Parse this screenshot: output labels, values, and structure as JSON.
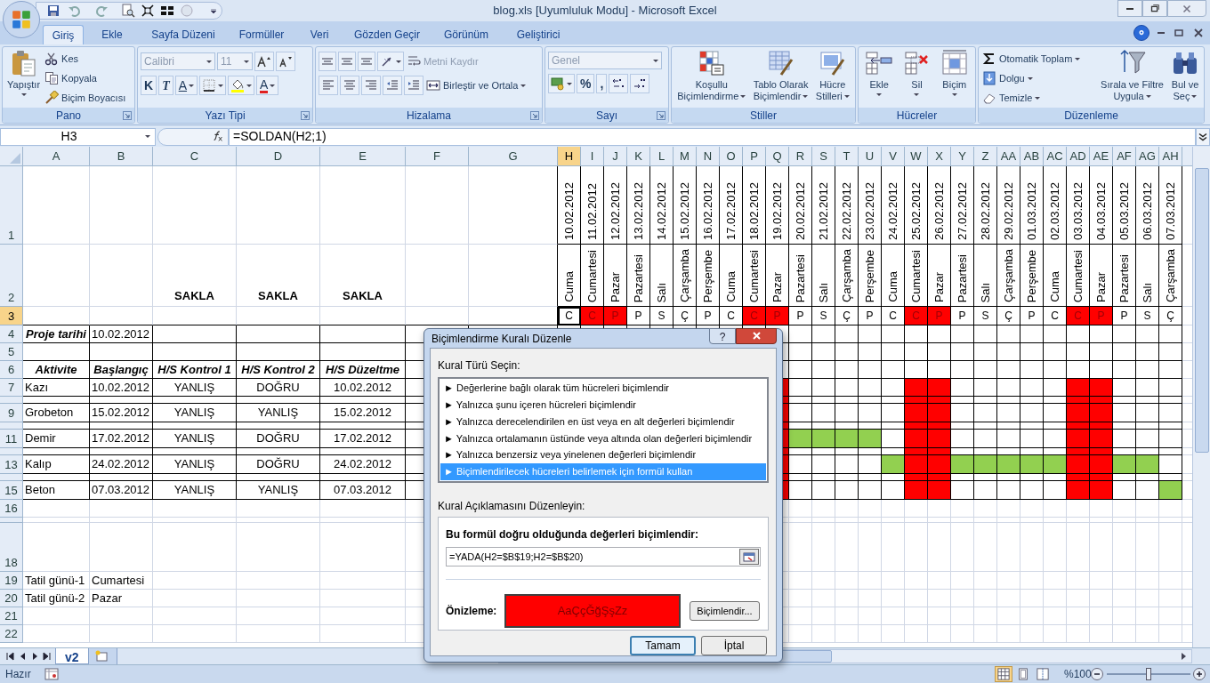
{
  "window": {
    "title": "blog.xls  [Uyumluluk Modu] - Microsoft Excel"
  },
  "ribbon_tabs": [
    {
      "label": "Giriş",
      "selected": true
    },
    {
      "label": "Ekle",
      "selected": false
    },
    {
      "label": "Sayfa Düzeni",
      "selected": false
    },
    {
      "label": "Formüller",
      "selected": false
    },
    {
      "label": "Veri",
      "selected": false
    },
    {
      "label": "Gözden Geçir",
      "selected": false
    },
    {
      "label": "Görünüm",
      "selected": false
    },
    {
      "label": "Geliştirici",
      "selected": false
    }
  ],
  "ribbon_groups": [
    {
      "title": "Pano",
      "kind": "large_first",
      "launcher": true,
      "items": [
        {
          "kind": "large",
          "lines": [
            "Yapıştır"
          ],
          "menu": true,
          "disabled": false
        },
        {
          "kind": "small",
          "label": "Kes",
          "menu": false,
          "disabled": false
        },
        {
          "kind": "small",
          "label": "Kopyala",
          "menu": false,
          "disabled": false
        },
        {
          "kind": "small",
          "label": "Biçim Boyacısı",
          "menu": false,
          "disabled": false
        }
      ]
    },
    {
      "title": "Yazı Tipi",
      "kind": "lines",
      "launcher": true,
      "lines": [
        [
          {
            "kind": "combo",
            "value": "Calibri",
            "menu": true,
            "disabled": true
          },
          {
            "kind": "combo",
            "value": "11",
            "menu": true,
            "disabled": true
          },
          {
            "kind": "icon",
            "menu": false,
            "disabled": false
          },
          {
            "kind": "icon",
            "menu": false,
            "disabled": false
          }
        ],
        [
          {
            "kind": "glyph",
            "label": "K",
            "menu": false,
            "disabled": false
          },
          {
            "kind": "glyph",
            "label": "T",
            "menu": false,
            "disabled": false
          },
          {
            "kind": "glyph",
            "label": "A",
            "menu": true,
            "disabled": false
          },
          {
            "kind": "icon",
            "menu": true,
            "disabled": false
          },
          {
            "kind": "icon",
            "menu": true,
            "disabled": false
          },
          {
            "kind": "glyph",
            "label": "A",
            "menu": true,
            "disabled": false
          }
        ]
      ]
    },
    {
      "title": "Hizalama",
      "kind": "lines",
      "launcher": true,
      "lines": [
        [
          {
            "kind": "icon",
            "menu": false,
            "disabled": false
          },
          {
            "kind": "icon",
            "menu": false,
            "disabled": false
          },
          {
            "kind": "icon",
            "menu": false,
            "disabled": false
          },
          {
            "kind": "icon",
            "menu": true,
            "disabled": false
          },
          {
            "kind": "small",
            "label": "Metni Kaydır",
            "menu": false,
            "disabled": true
          }
        ],
        [
          {
            "kind": "icon",
            "menu": false,
            "disabled": false
          },
          {
            "kind": "icon",
            "menu": false,
            "disabled": false
          },
          {
            "kind": "icon",
            "menu": false,
            "disabled": false
          },
          {
            "kind": "icon",
            "menu": false,
            "disabled": false
          },
          {
            "kind": "icon",
            "menu": false,
            "disabled": false
          },
          {
            "kind": "small",
            "label": "Birleştir ve Ortala",
            "menu": true,
            "disabled": false
          }
        ]
      ]
    },
    {
      "title": "Sayı",
      "kind": "lines",
      "launcher": true,
      "lines": [
        [
          {
            "kind": "combo",
            "value": "Genel",
            "menu": true,
            "disabled": true
          }
        ],
        [
          {
            "kind": "icon",
            "menu": true,
            "disabled": false
          },
          {
            "kind": "glyph",
            "label": "%",
            "menu": false,
            "disabled": false
          },
          {
            "kind": "glyph",
            "label": ",",
            "menu": false,
            "disabled": false
          },
          {
            "kind": "icon",
            "menu": false,
            "disabled": false
          },
          {
            "kind": "icon",
            "menu": false,
            "disabled": false
          }
        ]
      ]
    },
    {
      "title": "Stiller",
      "kind": "large_first",
      "launcher": false,
      "items": [
        {
          "kind": "large",
          "lines": [
            "Koşullu",
            "Biçimlendirme"
          ],
          "menu": true,
          "disabled": false
        },
        {
          "kind": "large",
          "lines": [
            "Tablo Olarak",
            "Biçimlendir"
          ],
          "menu": true,
          "disabled": false
        },
        {
          "kind": "large",
          "lines": [
            "Hücre",
            "Stilleri"
          ],
          "menu": true,
          "disabled": false
        }
      ]
    },
    {
      "title": "Hücreler",
      "kind": "large_first",
      "launcher": false,
      "items": [
        {
          "kind": "large",
          "lines": [
            "Ekle"
          ],
          "menu": true,
          "disabled": false
        },
        {
          "kind": "large",
          "lines": [
            "Sil"
          ],
          "menu": true,
          "disabled": false
        },
        {
          "kind": "large",
          "lines": [
            "Biçim"
          ],
          "menu": true,
          "disabled": false
        }
      ]
    },
    {
      "title": "Düzenleme",
      "kind": "stack_first",
      "launcher": false,
      "items": [
        {
          "kind": "small",
          "label": "Otomatik Toplam",
          "menu": true,
          "disabled": false
        },
        {
          "kind": "small",
          "label": "Dolgu",
          "menu": true,
          "disabled": false
        },
        {
          "kind": "small",
          "label": "Temizle",
          "menu": true,
          "disabled": false
        },
        {
          "kind": "large",
          "lines": [
            "Sırala ve Filtre",
            "Uygula"
          ],
          "menu": true,
          "disabled": false
        },
        {
          "kind": "large",
          "lines": [
            "Bul ve",
            "Seç"
          ],
          "menu": true,
          "disabled": false
        }
      ]
    }
  ],
  "formula_bar": {
    "name_box": "H3",
    "formula": "=SOLDAN(H2;1)"
  },
  "column_headers": [
    {
      "label": "A",
      "selected": false
    },
    {
      "label": "B",
      "selected": false
    },
    {
      "label": "C",
      "selected": false
    },
    {
      "label": "D",
      "selected": false
    },
    {
      "label": "E",
      "selected": false
    },
    {
      "label": "F",
      "selected": false
    },
    {
      "label": "G",
      "selected": false
    }
  ],
  "timeline_columns": [
    {
      "letter": "H",
      "date": "10.02.2012",
      "day": "Cuma",
      "initial": "C",
      "weekend": false,
      "selected": true
    },
    {
      "letter": "I",
      "date": "11.02.2012",
      "day": "Cumartesi",
      "initial": "C",
      "weekend": true,
      "selected": false
    },
    {
      "letter": "J",
      "date": "12.02.2012",
      "day": "Pazar",
      "initial": "P",
      "weekend": true,
      "selected": false
    },
    {
      "letter": "K",
      "date": "13.02.2012",
      "day": "Pazartesi",
      "initial": "P",
      "weekend": false,
      "selected": false
    },
    {
      "letter": "L",
      "date": "14.02.2012",
      "day": "Salı",
      "initial": "S",
      "weekend": false,
      "selected": false
    },
    {
      "letter": "M",
      "date": "15.02.2012",
      "day": "Çarşamba",
      "initial": "Ç",
      "weekend": false,
      "selected": false
    },
    {
      "letter": "N",
      "date": "16.02.2012",
      "day": "Perşembe",
      "initial": "P",
      "weekend": false,
      "selected": false
    },
    {
      "letter": "O",
      "date": "17.02.2012",
      "day": "Cuma",
      "initial": "C",
      "weekend": false,
      "selected": false
    },
    {
      "letter": "P",
      "date": "18.02.2012",
      "day": "Cumartesi",
      "initial": "C",
      "weekend": true,
      "selected": false
    },
    {
      "letter": "Q",
      "date": "19.02.2012",
      "day": "Pazar",
      "initial": "P",
      "weekend": true,
      "selected": false
    },
    {
      "letter": "R",
      "date": "20.02.2012",
      "day": "Pazartesi",
      "initial": "P",
      "weekend": false,
      "selected": false
    },
    {
      "letter": "S",
      "date": "21.02.2012",
      "day": "Salı",
      "initial": "S",
      "weekend": false,
      "selected": false
    },
    {
      "letter": "T",
      "date": "22.02.2012",
      "day": "Çarşamba",
      "initial": "Ç",
      "weekend": false,
      "selected": false
    },
    {
      "letter": "U",
      "date": "23.02.2012",
      "day": "Perşembe",
      "initial": "P",
      "weekend": false,
      "selected": false
    },
    {
      "letter": "V",
      "date": "24.02.2012",
      "day": "Cuma",
      "initial": "C",
      "weekend": false,
      "selected": false
    },
    {
      "letter": "W",
      "date": "25.02.2012",
      "day": "Cumartesi",
      "initial": "C",
      "weekend": true,
      "selected": false
    },
    {
      "letter": "X",
      "date": "26.02.2012",
      "day": "Pazar",
      "initial": "P",
      "weekend": true,
      "selected": false
    },
    {
      "letter": "Y",
      "date": "27.02.2012",
      "day": "Pazartesi",
      "initial": "P",
      "weekend": false,
      "selected": false
    },
    {
      "letter": "Z",
      "date": "28.02.2012",
      "day": "Salı",
      "initial": "S",
      "weekend": false,
      "selected": false
    },
    {
      "letter": "AA",
      "date": "29.02.2012",
      "day": "Çarşamba",
      "initial": "Ç",
      "weekend": false,
      "selected": false
    },
    {
      "letter": "AB",
      "date": "01.03.2012",
      "day": "Perşembe",
      "initial": "P",
      "weekend": false,
      "selected": false
    },
    {
      "letter": "AC",
      "date": "02.03.2012",
      "day": "Cuma",
      "initial": "C",
      "weekend": false,
      "selected": false
    },
    {
      "letter": "AD",
      "date": "03.03.2012",
      "day": "Cumartesi",
      "initial": "C",
      "weekend": true,
      "selected": false
    },
    {
      "letter": "AE",
      "date": "04.03.2012",
      "day": "Pazar",
      "initial": "P",
      "weekend": true,
      "selected": false
    },
    {
      "letter": "AF",
      "date": "05.03.2012",
      "day": "Pazartesi",
      "initial": "P",
      "weekend": false,
      "selected": false
    },
    {
      "letter": "AG",
      "date": "06.03.2012",
      "day": "Salı",
      "initial": "S",
      "weekend": false,
      "selected": false
    },
    {
      "letter": "AH",
      "date": "07.03.2012",
      "day": "Çarşamba",
      "initial": "Ç",
      "weekend": false,
      "selected": false
    }
  ],
  "rows": [
    {
      "number": "1",
      "selected": false,
      "cells": [
        null,
        null,
        null,
        null,
        null,
        null,
        null
      ]
    },
    {
      "number": "2",
      "selected": false,
      "cells": [
        null,
        null,
        {
          "text": "SAKLA",
          "kind": "caption"
        },
        {
          "text": "SAKLA",
          "kind": "caption"
        },
        {
          "text": "SAKLA",
          "kind": "caption"
        },
        null,
        null
      ]
    },
    {
      "number": "3",
      "selected": true,
      "cells": [
        null,
        null,
        null,
        null,
        null,
        null,
        null
      ]
    },
    {
      "number": "4",
      "selected": false,
      "cells": [
        {
          "text": "Proje tarihi",
          "kind": "header"
        },
        {
          "text": "10.02.2012",
          "kind": "label"
        },
        null,
        null,
        null,
        null,
        null
      ],
      "shaded": false
    },
    {
      "number": "5",
      "selected": false,
      "cells": [
        null,
        null,
        null,
        null,
        null,
        null,
        null
      ],
      "shaded": false
    },
    {
      "number": "6",
      "selected": false,
      "cells": [
        {
          "text": "Aktivite",
          "kind": "header"
        },
        {
          "text": "Başlangıç",
          "kind": "header"
        },
        {
          "text": "H/S Kontrol 1",
          "kind": "header"
        },
        {
          "text": "H/S Kontrol 2",
          "kind": "header"
        },
        {
          "text": "H/S Düzeltme",
          "kind": "header"
        },
        null,
        null
      ],
      "shaded": false
    },
    {
      "number": "7",
      "selected": false,
      "cells": [
        {
          "text": "Kazı",
          "kind": "label"
        },
        {
          "text": "10.02.2012",
          "kind": "label"
        },
        {
          "text": "YANLIŞ",
          "kind": "value"
        },
        {
          "text": "DOĞRU",
          "kind": "value"
        },
        {
          "text": "10.02.2012",
          "kind": "value"
        },
        null,
        null
      ],
      "shaded": true,
      "task_days": [
        false,
        false,
        false,
        false,
        false,
        false,
        false,
        false,
        false,
        false,
        false,
        false,
        false,
        false,
        false,
        false,
        false,
        false,
        false,
        false,
        false,
        false,
        false,
        false,
        false,
        false,
        false
      ]
    },
    {
      "selected": false,
      "cells": [
        null,
        null,
        null,
        null,
        null,
        null,
        null
      ],
      "shaded": true,
      "task_days": [
        false,
        false,
        false,
        false,
        false,
        false,
        false,
        false,
        false,
        false,
        false,
        false,
        false,
        false,
        false,
        false,
        false,
        false,
        false,
        false,
        false,
        false,
        false,
        false,
        false,
        false,
        false
      ]
    },
    {
      "number": "9",
      "selected": false,
      "cells": [
        {
          "text": "Grobeton",
          "kind": "label"
        },
        {
          "text": "15.02.2012",
          "kind": "label"
        },
        {
          "text": "YANLIŞ",
          "kind": "value"
        },
        {
          "text": "YANLIŞ",
          "kind": "value"
        },
        {
          "text": "15.02.2012",
          "kind": "value"
        },
        null,
        null
      ],
      "shaded": true,
      "task_days": [
        false,
        false,
        false,
        false,
        false,
        false,
        false,
        false,
        false,
        false,
        false,
        false,
        false,
        false,
        false,
        false,
        false,
        false,
        false,
        false,
        false,
        false,
        false,
        false,
        false,
        false,
        false
      ]
    },
    {
      "selected": false,
      "cells": [
        null,
        null,
        null,
        null,
        null,
        null,
        null
      ],
      "shaded": true,
      "task_days": [
        false,
        false,
        false,
        false,
        false,
        false,
        false,
        false,
        false,
        false,
        false,
        false,
        false,
        false,
        false,
        false,
        false,
        false,
        false,
        false,
        false,
        false,
        false,
        false,
        false,
        false,
        false
      ]
    },
    {
      "number": "11",
      "selected": false,
      "cells": [
        {
          "text": "Demir",
          "kind": "label"
        },
        {
          "text": "17.02.2012",
          "kind": "label"
        },
        {
          "text": "YANLIŞ",
          "kind": "value"
        },
        {
          "text": "DOĞRU",
          "kind": "value"
        },
        {
          "text": "17.02.2012",
          "kind": "value"
        },
        null,
        null
      ],
      "shaded": true,
      "task_days": [
        false,
        false,
        false,
        false,
        false,
        false,
        false,
        false,
        false,
        false,
        true,
        true,
        true,
        true,
        false,
        false,
        false,
        false,
        false,
        false,
        false,
        false,
        false,
        false,
        false,
        false,
        false
      ]
    },
    {
      "selected": false,
      "cells": [
        null,
        null,
        null,
        null,
        null,
        null,
        null
      ],
      "shaded": true,
      "task_days": [
        false,
        false,
        false,
        false,
        false,
        false,
        false,
        false,
        false,
        false,
        false,
        false,
        false,
        false,
        false,
        false,
        false,
        false,
        false,
        false,
        false,
        false,
        false,
        false,
        false,
        false,
        false
      ]
    },
    {
      "number": "13",
      "selected": false,
      "cells": [
        {
          "text": "Kalıp",
          "kind": "label"
        },
        {
          "text": "24.02.2012",
          "kind": "label"
        },
        {
          "text": "YANLIŞ",
          "kind": "value"
        },
        {
          "text": "DOĞRU",
          "kind": "value"
        },
        {
          "text": "24.02.2012",
          "kind": "value"
        },
        null,
        null
      ],
      "shaded": true,
      "task_days": [
        false,
        false,
        false,
        false,
        false,
        false,
        false,
        false,
        false,
        false,
        false,
        false,
        false,
        false,
        true,
        false,
        false,
        true,
        true,
        true,
        true,
        true,
        false,
        false,
        true,
        true,
        false
      ]
    },
    {
      "selected": false,
      "cells": [
        null,
        null,
        null,
        null,
        null,
        null,
        null
      ],
      "shaded": true,
      "task_days": [
        false,
        false,
        false,
        false,
        false,
        false,
        false,
        false,
        false,
        false,
        false,
        false,
        false,
        false,
        false,
        false,
        false,
        false,
        false,
        false,
        false,
        false,
        false,
        false,
        false,
        false,
        false
      ]
    },
    {
      "number": "15",
      "selected": false,
      "cells": [
        {
          "text": "Beton",
          "kind": "label"
        },
        {
          "text": "07.03.2012",
          "kind": "label"
        },
        {
          "text": "YANLIŞ",
          "kind": "value"
        },
        {
          "text": "YANLIŞ",
          "kind": "value"
        },
        {
          "text": "07.03.2012",
          "kind": "value"
        },
        null,
        null
      ],
      "shaded": true,
      "task_days": [
        false,
        false,
        false,
        false,
        false,
        false,
        false,
        false,
        false,
        false,
        false,
        false,
        false,
        false,
        false,
        false,
        false,
        false,
        false,
        false,
        false,
        false,
        false,
        false,
        false,
        false,
        true
      ]
    },
    {
      "number": "16",
      "selected": false,
      "cells": [
        null,
        null,
        null,
        null,
        null,
        null,
        null
      ]
    },
    {
      "selected": false,
      "cells": [
        null,
        null,
        null,
        null,
        null,
        null,
        null
      ]
    },
    {
      "number": "18",
      "selected": false,
      "cells": [
        null,
        null,
        null,
        null,
        null,
        null,
        null
      ]
    },
    {
      "number": "19",
      "selected": false,
      "cells": [
        {
          "text": "Tatil günü-1",
          "kind": "label"
        },
        {
          "text": "Cumartesi",
          "kind": "label"
        },
        null,
        null,
        null,
        null,
        null
      ]
    },
    {
      "number": "20",
      "selected": false,
      "cells": [
        {
          "text": "Tatil günü-2",
          "kind": "label"
        },
        {
          "text": "Pazar",
          "kind": "label"
        },
        null,
        null,
        null,
        null,
        null
      ]
    },
    {
      "number": "21",
      "selected": false,
      "cells": [
        null,
        null,
        null,
        null,
        null,
        null,
        null
      ]
    },
    {
      "number": "22",
      "selected": false,
      "cells": [
        null,
        null,
        null,
        null,
        null,
        null,
        null
      ]
    }
  ],
  "sheet_tabs": [
    {
      "label": "v2",
      "selected": true
    }
  ],
  "dialog": {
    "title": "Biçimlendirme Kuralı Düzenle",
    "help": "?",
    "rule_type_label": "Kural Türü Seçin:",
    "rule_types": [
      {
        "label": "► Değerlerine bağlı olarak tüm hücreleri biçimlendir",
        "selected": false
      },
      {
        "label": "► Yalnızca şunu içeren hücreleri biçimlendir",
        "selected": false
      },
      {
        "label": "► Yalnızca derecelendirilen en üst veya en alt değerleri biçimlendir",
        "selected": false
      },
      {
        "label": "► Yalnızca ortalamanın üstünde veya altında olan değerleri biçimlendir",
        "selected": false
      },
      {
        "label": "► Yalnızca benzersiz veya yinelenen değerleri biçimlendir",
        "selected": false
      },
      {
        "label": "► Biçimlendirilecek hücreleri belirlemek için formül kullan",
        "selected": true
      }
    ],
    "description_label": "Kural Açıklamasını Düzenleyin:",
    "formula_label": "Bu formül doğru olduğunda değerleri biçimlendir:",
    "formula": "=YADA(H2=$B$19;H2=$B$20)",
    "preview_label": "Önizleme:",
    "preview_text": "AaÇçĞğŞşZz",
    "format_button": "Biçimlendir...",
    "buttons": [
      {
        "label": "Tamam",
        "default": true
      },
      {
        "label": "İptal",
        "default": false
      }
    ]
  },
  "status_bar": {
    "status": "Hazır",
    "zoom": "%100",
    "zoom_level": {
      "level": 0.5
    }
  }
}
